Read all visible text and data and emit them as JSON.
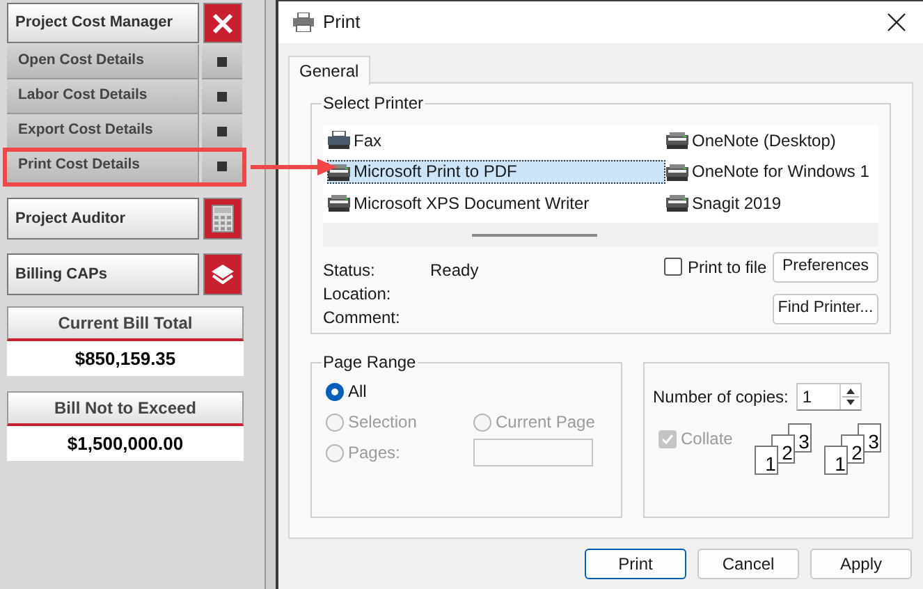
{
  "sidebar": {
    "header": {
      "label": "Project Cost Manager"
    },
    "sub_items": [
      {
        "label": "Open Cost Details",
        "highlighted": false
      },
      {
        "label": "Labor Cost Details",
        "highlighted": false
      },
      {
        "label": "Export Cost Details",
        "highlighted": false
      },
      {
        "label": "Print Cost Details",
        "highlighted": true
      }
    ],
    "tools": [
      {
        "label": "Project Auditor",
        "kind": "calculator"
      },
      {
        "label": "Billing CAPs",
        "kind": "layers"
      }
    ],
    "totals": [
      {
        "label": "Current Bill Total",
        "value": "$850,159.35"
      },
      {
        "label": "Bill Not to Exceed",
        "value": "$1,500,000.00"
      }
    ]
  },
  "dialog": {
    "title": "Print",
    "tabs": [
      {
        "label": "General",
        "selected": true
      }
    ],
    "select_printer": {
      "title": "Select Printer",
      "printers": [
        {
          "name": "Fax",
          "kind": "fax",
          "selected": false
        },
        {
          "name": "Microsoft Print to PDF",
          "kind": "printer",
          "selected": true
        },
        {
          "name": "Microsoft XPS Document Writer",
          "kind": "printer",
          "selected": false
        },
        {
          "name": "OneNote (Desktop)",
          "kind": "printer",
          "selected": false
        },
        {
          "name": "OneNote for Windows 1",
          "kind": "printer",
          "selected": false
        },
        {
          "name": "Snagit 2019",
          "kind": "printer",
          "selected": false
        }
      ],
      "info": [
        {
          "label": "Status:",
          "value": "Ready"
        },
        {
          "label": "Location:"
        },
        {
          "label": "Comment:"
        }
      ],
      "print_to_file": {
        "label": "Print to file",
        "checked": false
      },
      "buttons": [
        "Preferences",
        "Find Printer..."
      ]
    },
    "page_range": {
      "title": "Page Range",
      "options": [
        {
          "label": "All",
          "selected": true,
          "disabled": false
        },
        {
          "label": "Selection",
          "selected": false,
          "disabled": true
        },
        {
          "label": "Current Page",
          "selected": false,
          "disabled": true
        },
        {
          "label": "Pages:",
          "selected": false,
          "disabled": true
        }
      ]
    },
    "copies": {
      "label": "Number of copies:",
      "value": "1",
      "collate": {
        "label": "Collate",
        "checked": true,
        "disabled": true
      },
      "collate_stacks": [
        [
          "1",
          "2",
          "3"
        ],
        [
          "1",
          "2",
          "3"
        ]
      ]
    },
    "buttons": [
      {
        "label": "Print",
        "default": true
      },
      {
        "label": "Cancel",
        "default": false
      },
      {
        "label": "Apply",
        "default": false
      }
    ]
  }
}
